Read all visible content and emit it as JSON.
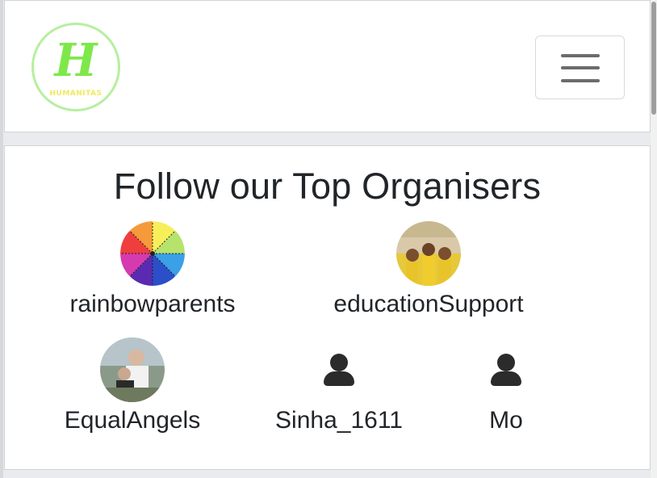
{
  "brand": {
    "monogram": "H",
    "wordmark": "HUMANITAS",
    "colors": {
      "ring": "#b6ef9f",
      "monogram": "#7ee84a",
      "wordmark": "#f2e95a"
    }
  },
  "navbar": {
    "toggler_icon": "hamburger-icon"
  },
  "section": {
    "title": "Follow our Top Organisers"
  },
  "organisers": [
    {
      "name": "rainbowparents",
      "avatar": "rainbow-wheel-avatar"
    },
    {
      "name": "educationSupport",
      "avatar": "group-photo-avatar"
    },
    {
      "name": "EqualAngels",
      "avatar": "people-photo-avatar"
    },
    {
      "name": "Sinha_1611",
      "avatar": "user-icon"
    },
    {
      "name": "Mo",
      "avatar": "user-icon"
    }
  ]
}
